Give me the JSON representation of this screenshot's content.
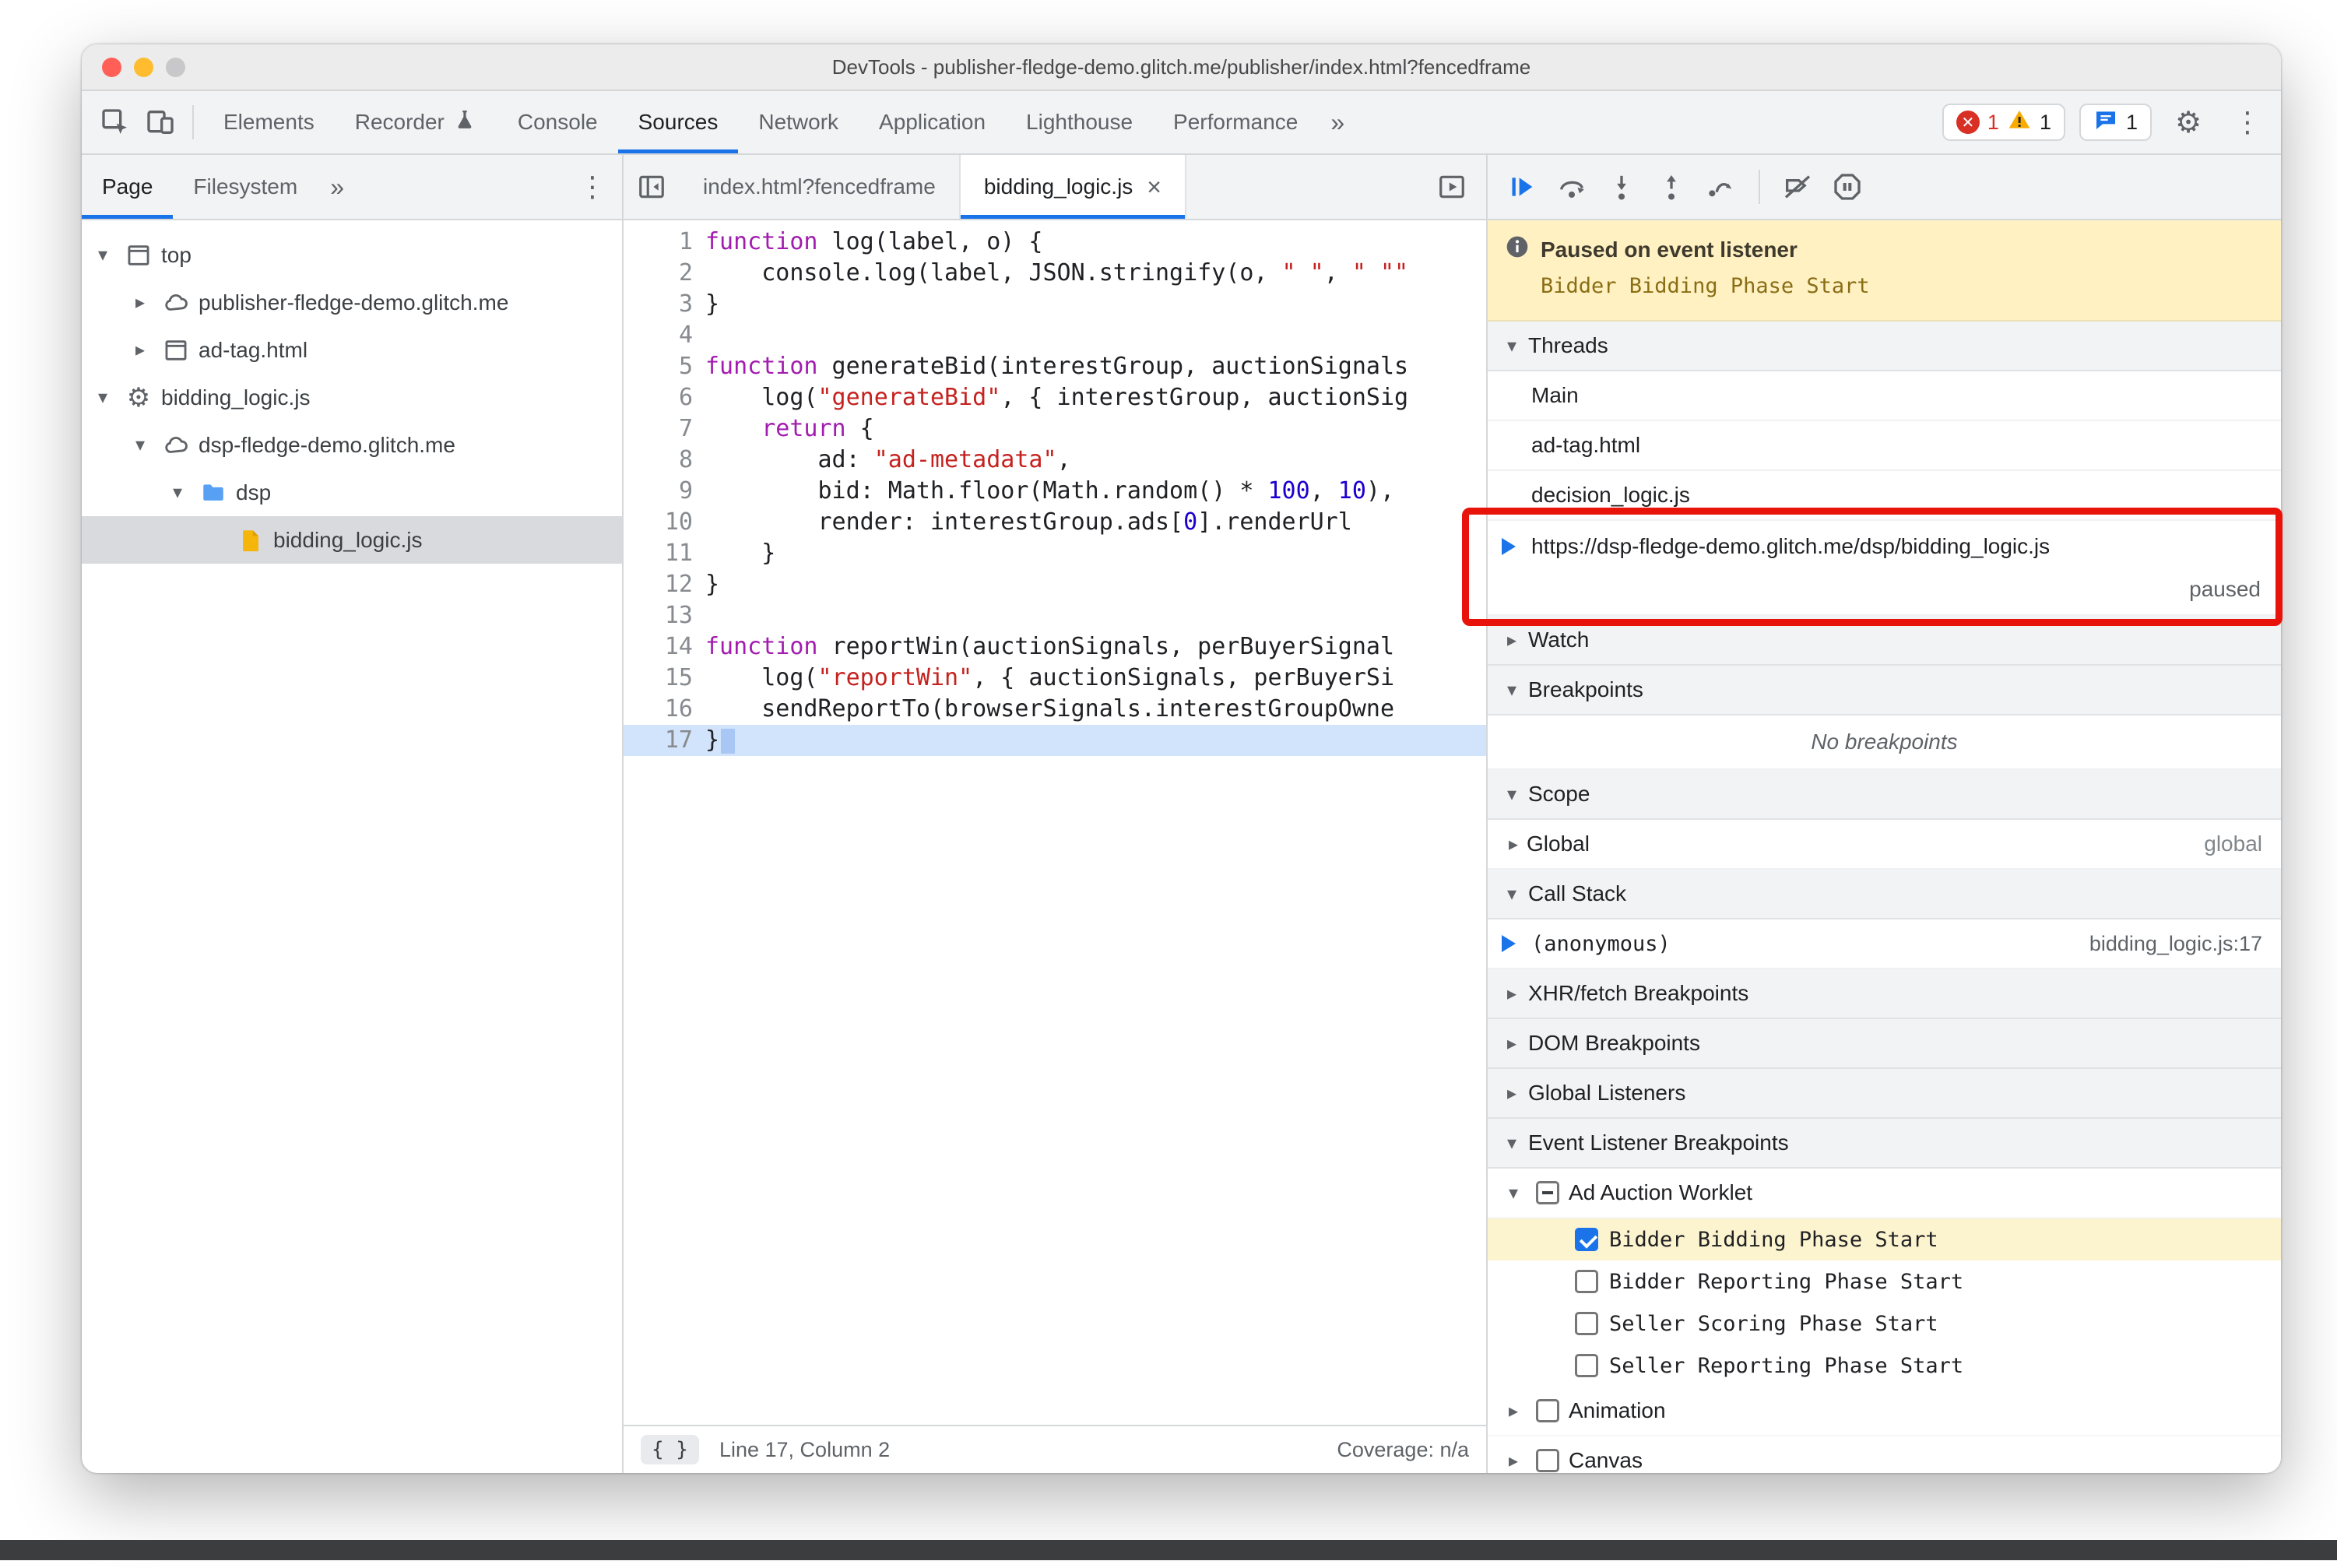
{
  "colors": {
    "accent": "#1a73e8",
    "error": "#d93025",
    "warning": "#f9ab00",
    "annotation_red": "#e8140c",
    "paused_banner_bg": "#fff1c2",
    "selected_breakpoint_bg": "#fcf3cf",
    "keyword": "#a21caf",
    "string": "#c5221f",
    "number": "#1c00cf"
  },
  "icons": {
    "settings": "⚙",
    "menu": "⋮",
    "more_tabs": "»",
    "close_tab": "×",
    "pretty_print": "{ }",
    "collapsed": "▸",
    "expanded": "▾"
  },
  "titlebar": {
    "title": "DevTools - publisher-fledge-demo.glitch.me/publisher/index.html?fencedframe"
  },
  "toolbar": {
    "tabs": [
      {
        "label": "Elements"
      },
      {
        "label": "Recorder",
        "icon": "experiment-icon"
      },
      {
        "label": "Console"
      },
      {
        "label": "Sources",
        "active": true
      },
      {
        "label": "Network"
      },
      {
        "label": "Application"
      },
      {
        "label": "Lighthouse"
      },
      {
        "label": "Performance"
      }
    ],
    "errors": "1",
    "warnings": "1",
    "issues": "1"
  },
  "navigator": {
    "tabs": [
      {
        "label": "Page",
        "active": true
      },
      {
        "label": "Filesystem"
      }
    ],
    "tree": [
      {
        "label": "top",
        "icon": "frame-icon",
        "level": 0,
        "state": "expanded"
      },
      {
        "label": "publisher-fledge-demo.glitch.me",
        "icon": "cloud-icon",
        "level": 1,
        "state": "collapsed"
      },
      {
        "label": "ad-tag.html",
        "icon": "frame-icon",
        "level": 1,
        "state": "collapsed"
      },
      {
        "label": "bidding_logic.js",
        "icon": "worker-icon",
        "level": 0,
        "state": "expanded"
      },
      {
        "label": "dsp-fledge-demo.glitch.me",
        "icon": "cloud-icon",
        "level": 1,
        "state": "expanded"
      },
      {
        "label": "dsp",
        "icon": "folder-icon",
        "level": 2,
        "state": "expanded"
      },
      {
        "label": "bidding_logic.js",
        "icon": "file-icon",
        "level": 3,
        "state": "none",
        "selected": true
      }
    ]
  },
  "editor": {
    "tabs": [
      {
        "label": "index.html?fencedframe"
      },
      {
        "label": "bidding_logic.js",
        "active": true,
        "closable": true
      }
    ],
    "status": {
      "position": "Line 17, Column 2",
      "coverage": "Coverage: n/a"
    },
    "code": [
      {
        "n": 1,
        "s": [
          {
            "t": "function",
            "c": "kw"
          },
          {
            "t": " log(label, o) {"
          }
        ]
      },
      {
        "n": 2,
        "s": [
          {
            "t": "    console.log(label, JSON.stringify(o, "
          },
          {
            "t": "\" \"",
            "c": "str"
          },
          {
            "t": ", "
          },
          {
            "t": "\" \"",
            "c": "str"
          },
          {
            "t": "\"",
            "c": "str"
          }
        ]
      },
      {
        "n": 3,
        "s": [
          {
            "t": "}"
          }
        ]
      },
      {
        "n": 4,
        "s": []
      },
      {
        "n": 5,
        "s": [
          {
            "t": "function",
            "c": "kw"
          },
          {
            "t": " generateBid(interestGroup, auctionSignals"
          }
        ]
      },
      {
        "n": 6,
        "s": [
          {
            "t": "    log("
          },
          {
            "t": "\"generateBid\"",
            "c": "str"
          },
          {
            "t": ", { interestGroup, auctionSig"
          }
        ]
      },
      {
        "n": 7,
        "s": [
          {
            "t": "    "
          },
          {
            "t": "return",
            "c": "kw"
          },
          {
            "t": " {"
          }
        ]
      },
      {
        "n": 8,
        "s": [
          {
            "t": "        ad: "
          },
          {
            "t": "\"ad-metadata\"",
            "c": "str"
          },
          {
            "t": ","
          }
        ]
      },
      {
        "n": 9,
        "s": [
          {
            "t": "        bid: Math.floor(Math.random() * "
          },
          {
            "t": "100",
            "c": "num"
          },
          {
            "t": ", "
          },
          {
            "t": "10",
            "c": "num"
          },
          {
            "t": "),"
          }
        ]
      },
      {
        "n": 10,
        "s": [
          {
            "t": "        render: interestGroup.ads["
          },
          {
            "t": "0",
            "c": "num"
          },
          {
            "t": "].renderUrl"
          }
        ]
      },
      {
        "n": 11,
        "s": [
          {
            "t": "    }"
          }
        ]
      },
      {
        "n": 12,
        "s": [
          {
            "t": "}"
          }
        ]
      },
      {
        "n": 13,
        "s": []
      },
      {
        "n": 14,
        "s": [
          {
            "t": "function",
            "c": "kw"
          },
          {
            "t": " reportWin(auctionSignals, perBuyerSignal"
          }
        ]
      },
      {
        "n": 15,
        "s": [
          {
            "t": "    log("
          },
          {
            "t": "\"reportWin\"",
            "c": "str"
          },
          {
            "t": ", { auctionSignals, perBuyerSi"
          }
        ]
      },
      {
        "n": 16,
        "s": [
          {
            "t": "    sendReportTo(browserSignals.interestGroupOwne"
          }
        ]
      },
      {
        "n": 17,
        "s": [
          {
            "t": "}"
          }
        ],
        "active": true
      }
    ]
  },
  "debugger": {
    "paused": {
      "title": "Paused on event listener",
      "detail": "Bidder Bidding Phase Start"
    },
    "threads": {
      "title": "Threads",
      "items": [
        {
          "label": "Main"
        },
        {
          "label": "ad-tag.html"
        },
        {
          "label": "decision_logic.js"
        },
        {
          "label": "https://dsp-fledge-demo.glitch.me/dsp/bidding_logic.js",
          "current": true,
          "status": "paused"
        }
      ]
    },
    "watch": {
      "title": "Watch"
    },
    "breakpoints": {
      "title": "Breakpoints",
      "empty": "No breakpoints"
    },
    "scope": {
      "title": "Scope",
      "rows": [
        {
          "label": "Global",
          "value": "global"
        }
      ]
    },
    "call_stack": {
      "title": "Call Stack",
      "frames": [
        {
          "label": "(anonymous)",
          "location": "bidding_logic.js:17",
          "current": true
        }
      ]
    },
    "sections": [
      "XHR/fetch Breakpoints",
      "DOM Breakpoints",
      "Global Listeners"
    ],
    "event_listener_breakpoints": {
      "title": "Event Listener Breakpoints",
      "groups": [
        {
          "label": "Ad Auction Worklet",
          "expanded": true,
          "checkbox": "indeterminate",
          "children": [
            {
              "label": "Bidder Bidding Phase Start",
              "checked": true,
              "highlighted": true
            },
            {
              "label": "Bidder Reporting Phase Start",
              "checked": false
            },
            {
              "label": "Seller Scoring Phase Start",
              "checked": false
            },
            {
              "label": "Seller Reporting Phase Start",
              "checked": false
            }
          ]
        },
        {
          "label": "Animation",
          "expanded": false,
          "checkbox": "unchecked",
          "children": []
        },
        {
          "label": "Canvas",
          "expanded": false,
          "checkbox": "unchecked",
          "children": []
        }
      ]
    }
  }
}
